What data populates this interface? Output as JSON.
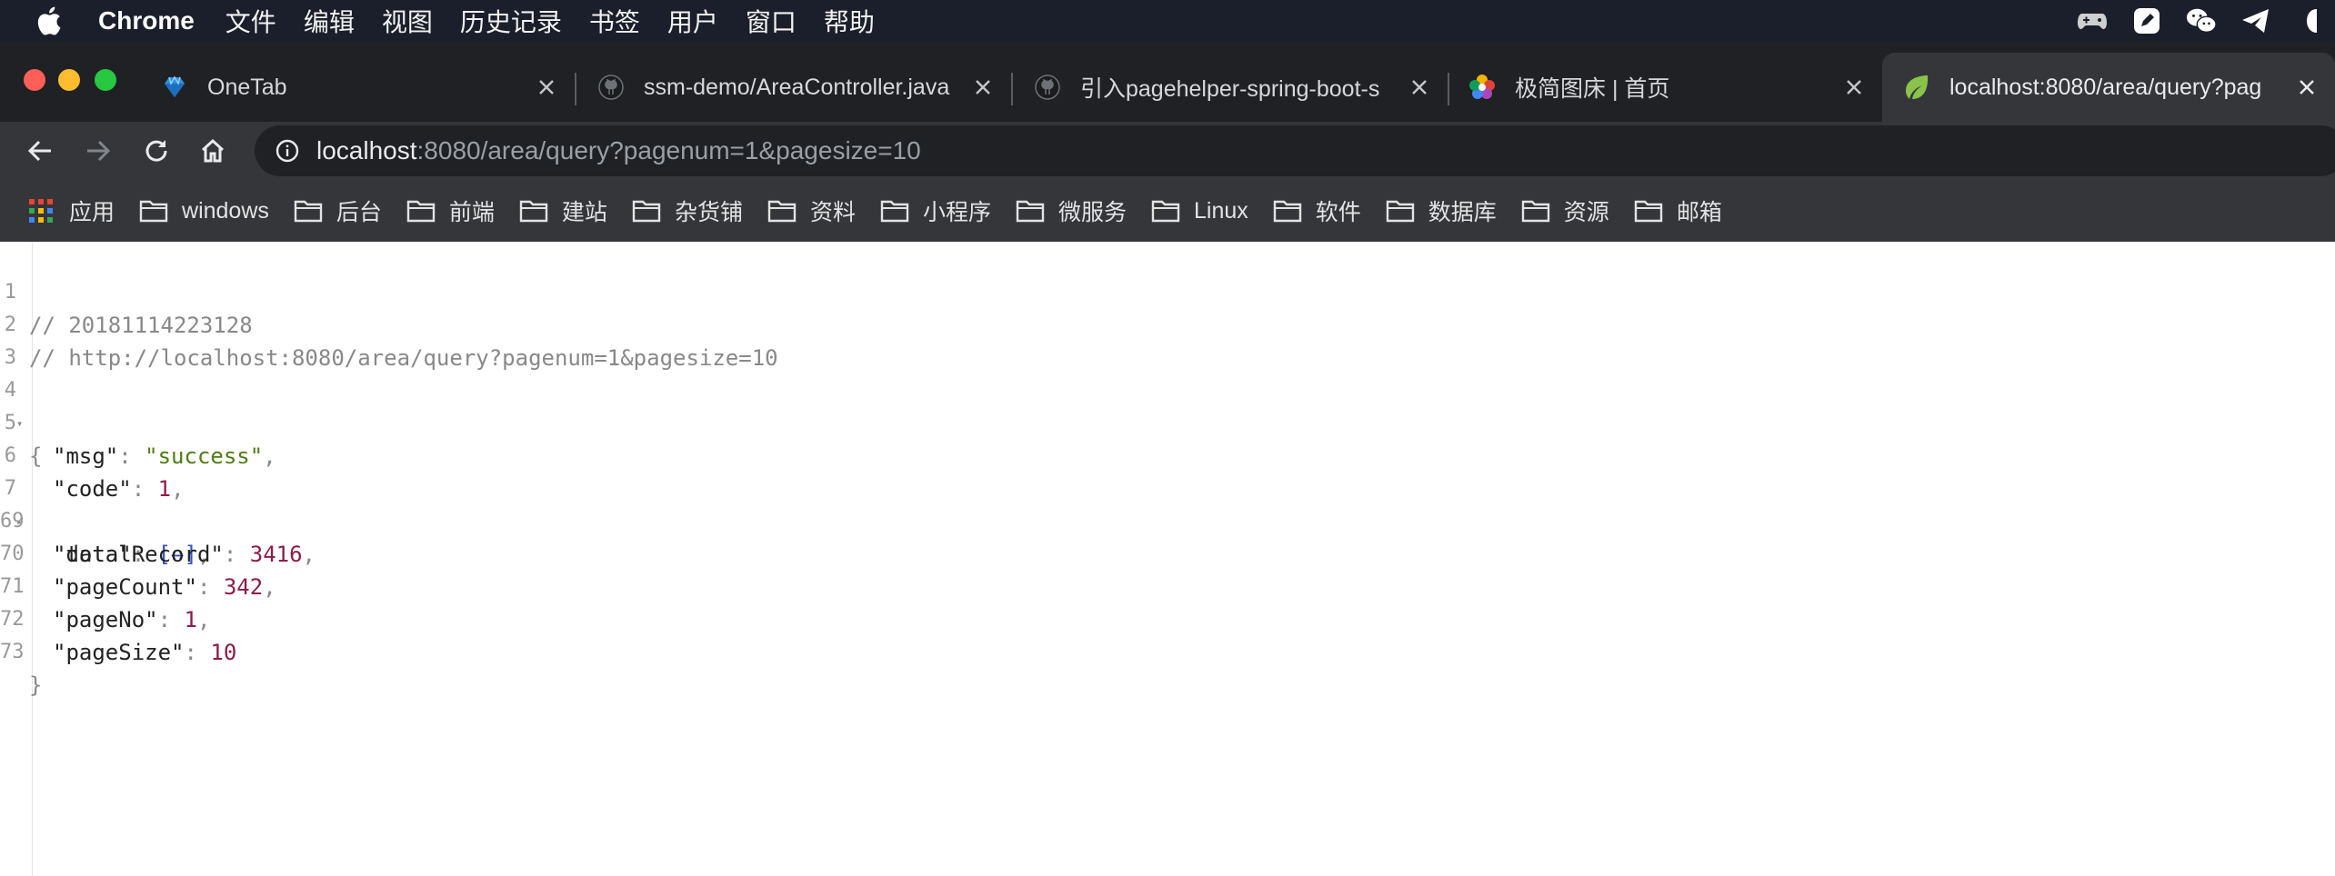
{
  "menubar": {
    "app_name": "Chrome",
    "items": [
      "文件",
      "编辑",
      "视图",
      "历史记录",
      "书签",
      "用户",
      "窗口",
      "帮助"
    ]
  },
  "tabs": [
    {
      "title": "OneTab",
      "icon": "onetab-diamond-icon"
    },
    {
      "title": "ssm-demo/AreaController.java",
      "icon": "github-icon"
    },
    {
      "title": "引入pagehelper-spring-boot-s",
      "icon": "github-icon"
    },
    {
      "title": "极简图床 | 首页",
      "icon": "pinwheel-icon"
    },
    {
      "title": "localhost:8080/area/query?pag",
      "icon": "spring-leaf-icon",
      "active": true
    }
  ],
  "address_bar": {
    "host": "localhost",
    "rest": ":8080/area/query?pagenum=1&pagesize=10"
  },
  "bookmarks": [
    "应用",
    "windows",
    "后台",
    "前端",
    "建站",
    "杂货铺",
    "资料",
    "小程序",
    "微服务",
    "Linux",
    "软件",
    "数据库",
    "资源",
    "邮箱"
  ],
  "json_view": {
    "line_numbers": [
      "1",
      "2",
      "3",
      "4",
      "5",
      "6",
      "7",
      "69",
      "70",
      "71",
      "72",
      "73"
    ],
    "comment_timestamp": "// 20181114223128",
    "comment_url": "// http://localhost:8080/area/query?pagenum=1&pagesize=10",
    "open_brace": "{",
    "close_brace": "}",
    "fields": [
      {
        "key": "\"msg\"",
        "value": "\"success\"",
        "type": "string"
      },
      {
        "key": "\"code\"",
        "value": "1",
        "type": "number"
      },
      {
        "key": "\"data\"",
        "value": "[↔]",
        "type": "collapsed"
      },
      {
        "key": "\"totalRecord\"",
        "value": "3416",
        "type": "number"
      },
      {
        "key": "\"pageCount\"",
        "value": "342",
        "type": "number"
      },
      {
        "key": "\"pageNo\"",
        "value": "1",
        "type": "number"
      },
      {
        "key": "\"pageSize\"",
        "value": "10",
        "type": "number"
      }
    ]
  },
  "colors": {
    "menubar_bg": "#1b1f2b",
    "tabstrip_bg": "#202124",
    "toolbar_bg": "#35363a",
    "json_string": "#4f7d13",
    "json_number": "#8c1c49"
  }
}
